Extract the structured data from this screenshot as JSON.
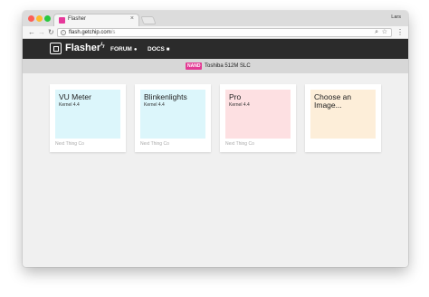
{
  "browser": {
    "tab_title": "Flasher",
    "tab_close": "×",
    "profile_name": "Lars",
    "url_host": "flash.getchip.com",
    "url_path": "/s"
  },
  "header": {
    "brand": "Flasher",
    "nav": [
      {
        "label": "FORUM",
        "icon": "chat-icon"
      },
      {
        "label": "DOCS",
        "icon": "book-icon"
      }
    ]
  },
  "device": {
    "badge": "NAND",
    "name": "Toshiba 512M SLC"
  },
  "images": [
    {
      "title": "VU Meter",
      "kernel": "Kernel 4.4",
      "vendor": "Next Thing Co",
      "color": "#dcf6fb"
    },
    {
      "title": "Blinkenlights",
      "kernel": "Kernel 4.4",
      "vendor": "Next Thing Co",
      "color": "#dcf6fb"
    },
    {
      "title": "Pro",
      "kernel": "Kernel 4.4",
      "vendor": "Next Thing Co",
      "color": "#fde0e2"
    },
    {
      "title": "Choose an Image...",
      "kernel": "",
      "vendor": "",
      "color": "#fdeed9"
    }
  ],
  "colors": {
    "accent": "#e33a94",
    "header_bg": "#2b2b2b"
  }
}
